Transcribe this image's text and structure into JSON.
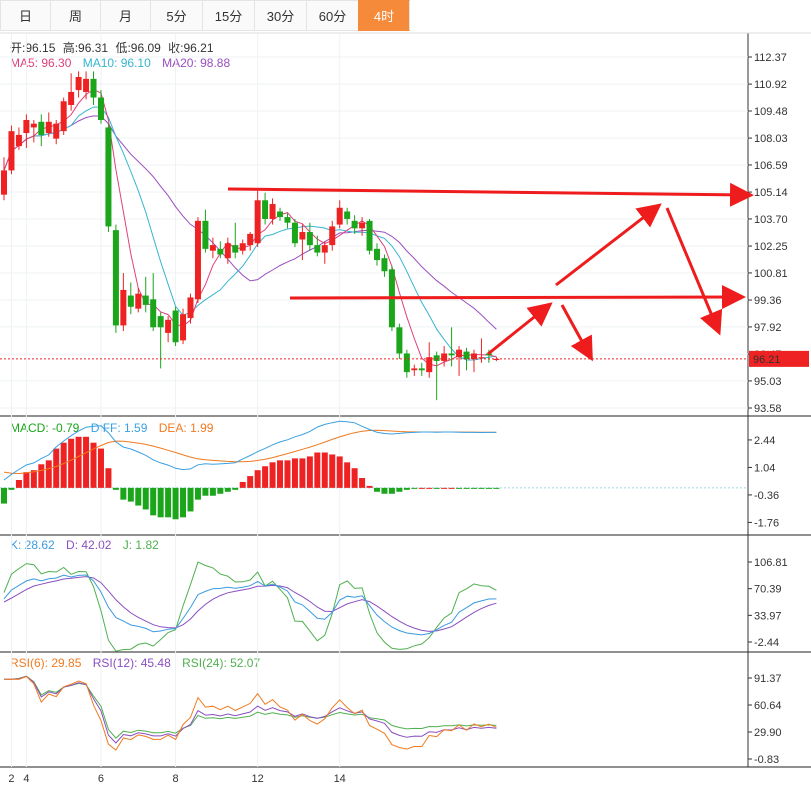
{
  "tabs": [
    {
      "label": "日",
      "active": false
    },
    {
      "label": "周",
      "active": false
    },
    {
      "label": "月",
      "active": false
    },
    {
      "label": "5分",
      "active": false
    },
    {
      "label": "15分",
      "active": false
    },
    {
      "label": "30分",
      "active": false
    },
    {
      "label": "60分",
      "active": false
    },
    {
      "label": "4时",
      "active": true
    }
  ],
  "ohlc_info": {
    "open": "开:96.15",
    "high": "高:96.31",
    "low": "低:96.09",
    "close": "收:96.21"
  },
  "ma_info": {
    "ma5": "MA5: 96.30",
    "ma10": "MA10: 96.10",
    "ma20": "MA20: 98.88"
  },
  "macd_info": {
    "macd": "MACD: -0.79",
    "diff": "DIFF: 1.59",
    "dea": "DEA: 1.99"
  },
  "kdj_info": {
    "k": "K: 28.62",
    "d": "D: 42.02",
    "j": "J: 1.82"
  },
  "rsi_info": {
    "rsi6": "RSI(6): 29.85",
    "rsi12": "RSI(12): 45.48",
    "rsi24": "RSI(24): 52.07"
  },
  "colors": {
    "up": "#ee2222",
    "down": "#1aa51a",
    "ma5": "#e0407a",
    "ma10": "#35b5d0",
    "ma20": "#9a4fc0",
    "diff": "#3aa0e0",
    "dea": "#f07a20",
    "k": "#3a9ae0",
    "d": "#8a4fc0",
    "j": "#4fb04f",
    "rsi6": "#f07a20",
    "rsi12": "#8a4fc0",
    "rsi24": "#4fb04f",
    "arrow": "#ee1c1c",
    "tab_active": "#f58a3a"
  },
  "chart_data": {
    "type": "candlestick",
    "price_axis": {
      "ticks": [
        "112.37",
        "110.92",
        "109.48",
        "108.03",
        "106.59",
        "105.14",
        "103.70",
        "102.25",
        "100.81",
        "99.36",
        "97.92",
        "96.47",
        "95.03",
        "93.58"
      ],
      "ylim": [
        93.58,
        112.37
      ],
      "current_price": "96.21"
    },
    "x_ticks": [
      {
        "label": "2",
        "i": 1
      },
      {
        "label": "4",
        "i": 3
      },
      {
        "label": "6",
        "i": 13
      },
      {
        "label": "8",
        "i": 23
      },
      {
        "label": "12",
        "i": 34
      },
      {
        "label": "14",
        "i": 45
      }
    ],
    "candles": [
      [
        105.0,
        106.3,
        107.0,
        104.7
      ],
      [
        106.3,
        108.4,
        108.7,
        106.1
      ],
      [
        107.6,
        108.2,
        108.6,
        107.4
      ],
      [
        108.3,
        109.0,
        109.3,
        107.5
      ],
      [
        108.6,
        108.8,
        109.0,
        107.8
      ],
      [
        108.9,
        108.2,
        109.3,
        107.6
      ],
      [
        108.3,
        108.9,
        109.4,
        108.1
      ],
      [
        108.0,
        108.8,
        109.0,
        107.7
      ],
      [
        108.4,
        110.0,
        110.2,
        108.2
      ],
      [
        109.8,
        110.5,
        111.5,
        109.5
      ],
      [
        110.6,
        111.3,
        111.6,
        110.2
      ],
      [
        110.5,
        111.2,
        111.6,
        110.1
      ],
      [
        111.2,
        110.2,
        111.6,
        109.8
      ],
      [
        110.2,
        109.0,
        110.6,
        108.8
      ],
      [
        108.6,
        103.3,
        108.8,
        103.0
      ],
      [
        103.1,
        98.0,
        103.4,
        97.6
      ],
      [
        98.0,
        99.9,
        100.8,
        97.7
      ],
      [
        99.6,
        99.0,
        100.3,
        98.6
      ],
      [
        98.9,
        99.7,
        100.0,
        98.7
      ],
      [
        99.6,
        99.1,
        100.6,
        98.7
      ],
      [
        99.4,
        97.9,
        100.8,
        97.7
      ],
      [
        98.5,
        97.9,
        98.7,
        95.7
      ],
      [
        97.6,
        98.3,
        98.5,
        97.1
      ],
      [
        98.8,
        97.1,
        99.0,
        96.9
      ],
      [
        97.2,
        98.6,
        98.9,
        97.0
      ],
      [
        98.4,
        99.5,
        99.7,
        98.1
      ],
      [
        99.4,
        103.6,
        103.8,
        99.2
      ],
      [
        103.6,
        102.1,
        104.2,
        101.9
      ],
      [
        102.0,
        102.3,
        102.7,
        101.6
      ],
      [
        102.1,
        101.8,
        102.5,
        101.6
      ],
      [
        101.6,
        102.4,
        102.7,
        101.3
      ],
      [
        102.3,
        101.9,
        103.5,
        101.6
      ],
      [
        102.0,
        102.4,
        102.6,
        101.8
      ],
      [
        102.3,
        102.9,
        103.0,
        102.0
      ],
      [
        102.4,
        104.7,
        105.2,
        102.2
      ],
      [
        104.7,
        103.7,
        105.1,
        103.4
      ],
      [
        103.7,
        104.5,
        104.8,
        103.4
      ],
      [
        104.1,
        103.8,
        104.3,
        103.6
      ],
      [
        103.8,
        103.5,
        104.0,
        103.2
      ],
      [
        103.5,
        102.4,
        103.7,
        102.2
      ],
      [
        102.6,
        103.0,
        103.4,
        101.5
      ],
      [
        103.0,
        102.3,
        103.5,
        102.0
      ],
      [
        102.3,
        101.9,
        102.8,
        101.7
      ],
      [
        101.9,
        102.3,
        102.5,
        101.3
      ],
      [
        102.3,
        103.3,
        103.6,
        102.0
      ],
      [
        103.4,
        104.3,
        104.7,
        103.2
      ],
      [
        104.1,
        103.7,
        104.3,
        103.4
      ],
      [
        103.6,
        103.2,
        103.9,
        102.9
      ],
      [
        103.2,
        103.5,
        103.8,
        102.8
      ],
      [
        103.6,
        102.0,
        103.7,
        101.8
      ],
      [
        102.1,
        101.5,
        102.4,
        101.2
      ],
      [
        101.6,
        100.9,
        101.8,
        100.6
      ],
      [
        101.0,
        97.9,
        101.2,
        97.7
      ],
      [
        97.9,
        96.5,
        98.1,
        96.2
      ],
      [
        96.5,
        95.5,
        96.7,
        95.2
      ],
      [
        95.6,
        95.7,
        95.9,
        95.3
      ],
      [
        95.7,
        95.6,
        96.0,
        95.3
      ],
      [
        95.5,
        96.3,
        97.1,
        95.2
      ],
      [
        96.4,
        96.1,
        96.6,
        94.0
      ],
      [
        96.1,
        96.5,
        96.9,
        95.8
      ],
      [
        96.5,
        96.4,
        97.9,
        95.8
      ],
      [
        96.3,
        96.7,
        96.9,
        95.3
      ],
      [
        96.6,
        96.2,
        96.8,
        95.6
      ],
      [
        96.2,
        96.5,
        96.7,
        95.5
      ],
      [
        96.3,
        96.3,
        97.3,
        96.0
      ],
      [
        96.5,
        96.4,
        96.7,
        96.0
      ],
      [
        96.15,
        96.21,
        96.31,
        96.09
      ]
    ],
    "macd_axis": {
      "ticks": [
        "2.44",
        "1.04",
        "-0.36",
        "-1.76"
      ],
      "ylim": [
        -2.4,
        3.2
      ]
    },
    "macd_hist": [
      -0.8,
      -0.1,
      0.4,
      0.8,
      0.9,
      1.2,
      1.4,
      2.0,
      2.3,
      2.5,
      2.6,
      2.6,
      2.3,
      2.0,
      1.0,
      -0.1,
      -0.6,
      -0.7,
      -0.9,
      -1.1,
      -1.4,
      -1.5,
      -1.5,
      -1.6,
      -1.5,
      -1.2,
      -0.6,
      -0.4,
      -0.4,
      -0.3,
      -0.2,
      -0.1,
      0.3,
      0.6,
      0.9,
      1.1,
      1.3,
      1.4,
      1.4,
      1.5,
      1.5,
      1.6,
      1.8,
      1.8,
      1.7,
      1.6,
      1.3,
      1.0,
      0.5,
      0.1,
      -0.2,
      -0.3,
      -0.3,
      -0.2,
      -0.1,
      -0.05,
      0.0,
      0.0,
      -0.03,
      0.0,
      0.0,
      -0.02,
      -0.03,
      -0.03,
      -0.03,
      -0.02,
      -0.02
    ],
    "kdj_axis": {
      "ticks": [
        "106.81",
        "70.39",
        "33.97",
        "-2.44"
      ],
      "ylim": [
        -2.44,
        106.81
      ]
    },
    "rsi_axis": {
      "ticks": [
        "91.37",
        "60.64",
        "29.90",
        "-0.83"
      ],
      "ylim": [
        -0.83,
        91.37
      ]
    }
  }
}
